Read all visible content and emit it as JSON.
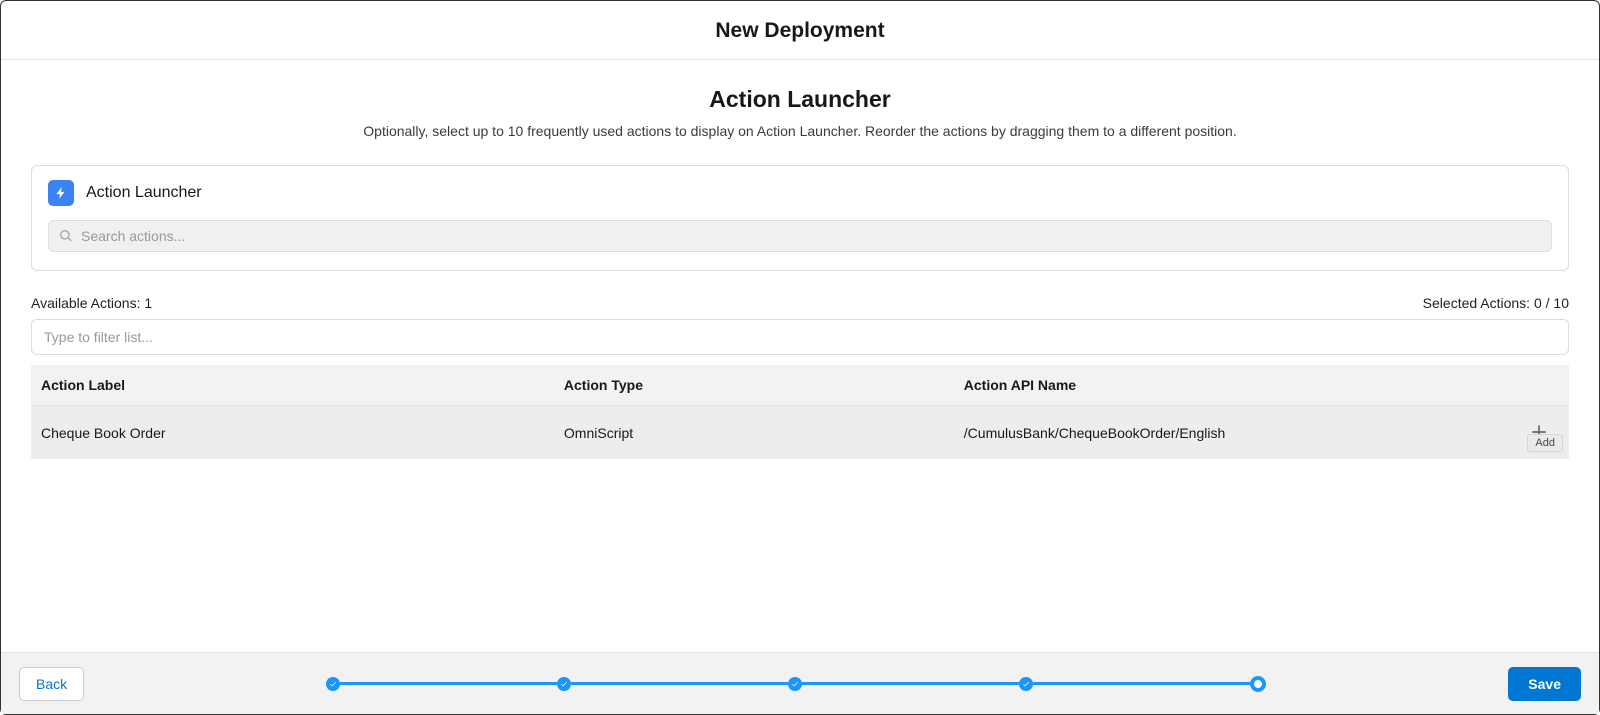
{
  "modal": {
    "title": "New Deployment"
  },
  "section": {
    "title": "Action Launcher",
    "subtitle": "Optionally, select up to 10 frequently used actions to display on Action Launcher. Reorder the actions by dragging them to a different position."
  },
  "launcher": {
    "label": "Action Launcher",
    "search_placeholder": "Search actions..."
  },
  "counts": {
    "available": "Available Actions: 1",
    "selected": "Selected Actions: 0 / 10"
  },
  "filter": {
    "placeholder": "Type to filter list..."
  },
  "table": {
    "headers": {
      "label": "Action Label",
      "type": "Action Type",
      "api": "Action API Name"
    },
    "rows": [
      {
        "label": "Cheque Book Order",
        "type": "OmniScript",
        "api": "/CumulusBank/ChequeBookOrder/English"
      }
    ]
  },
  "tooltip": {
    "add": "Add"
  },
  "footer": {
    "back": "Back",
    "save": "Save"
  }
}
